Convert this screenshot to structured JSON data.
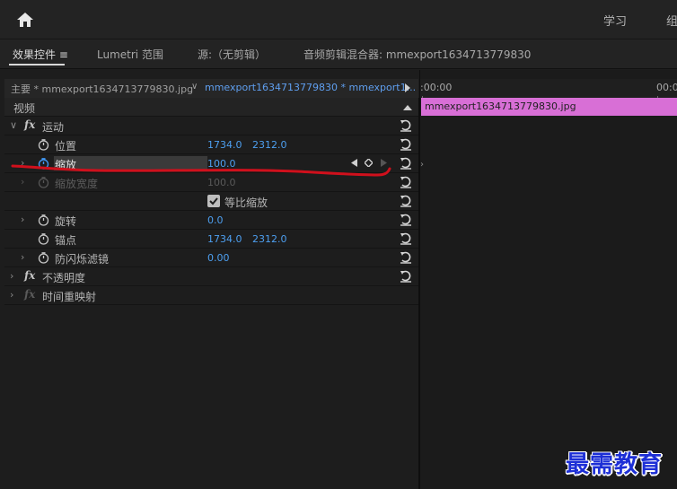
{
  "topbar": {
    "workspace_1": "学习",
    "workspace_2": "组"
  },
  "tabs": {
    "effect_controls": "效果控件 ≡",
    "lumetri": "Lumetri 范围",
    "source": "源:（无剪辑）",
    "audio_mixer": "音频剪辑混合器: mmexport1634713779830"
  },
  "source_bar": {
    "master": "主要 * mmexport1634713779830.jpg",
    "clip": "mmexport1634713779830 * mmexport1..."
  },
  "sections": {
    "video": "视频",
    "motion": "运动",
    "opacity": "不透明度",
    "time_remap": "时间重映射"
  },
  "properties": {
    "position": {
      "label": "位置",
      "x": "1734.0",
      "y": "2312.0"
    },
    "scale": {
      "label": "缩放",
      "value": "100.0"
    },
    "scale_width": {
      "label": "缩放宽度",
      "value": "100.0"
    },
    "uniform_scale": {
      "label": "等比缩放",
      "checked": true
    },
    "rotation": {
      "label": "旋转",
      "value": "0.0"
    },
    "anchor": {
      "label": "锚点",
      "x": "1734.0",
      "y": "2312.0"
    },
    "anti_flicker": {
      "label": "防闪烁滤镜",
      "value": "0.00"
    }
  },
  "timeline": {
    "time_start": ":00:00",
    "time_end": "00:0",
    "clip_name": "mmexport1634713779830.jpg",
    "clip_color": "#d86fd6"
  },
  "fx_label": "fx",
  "watermark": "最需教育",
  "colors": {
    "value_blue": "#4d9ff0",
    "annotation_red": "#d0101c"
  }
}
